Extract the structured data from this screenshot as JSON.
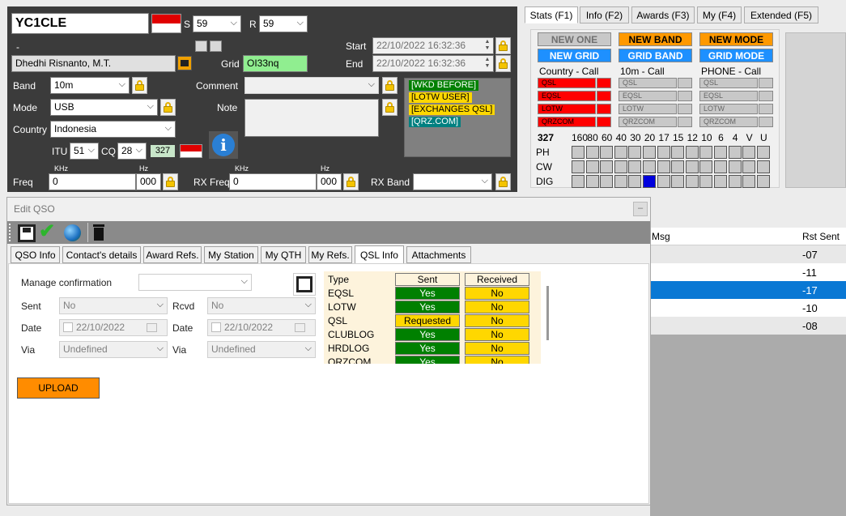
{
  "callsign": "YC1CLE",
  "rst": {
    "s_label": "S",
    "s_value": "59",
    "r_label": "R",
    "r_value": "59"
  },
  "operator_name": "Dhedhi Risnanto, M.T.",
  "dash": "-",
  "start": {
    "label": "Start",
    "value": "22/10/2022 16:32:36"
  },
  "end": {
    "label": "End",
    "value": "22/10/2022 16:32:36"
  },
  "grid": {
    "label": "Grid",
    "value": "OI33nq"
  },
  "band": {
    "label": "Band",
    "value": "10m"
  },
  "mode": {
    "label": "Mode",
    "value": "USB"
  },
  "country": {
    "label": "Country",
    "value": "Indonesia"
  },
  "itu": {
    "label": "ITU",
    "value": "51"
  },
  "cq": {
    "label": "CQ",
    "value": "28"
  },
  "dxcc": "327",
  "comment": {
    "label": "Comment",
    "value": ""
  },
  "note": {
    "label": "Note",
    "value": ""
  },
  "tags": [
    {
      "text": "[WKD BEFORE]",
      "bg": "#008000",
      "fg": "#ffffff"
    },
    {
      "text": "[LOTW USER]",
      "bg": "#ffd700",
      "fg": "#000000"
    },
    {
      "text": "[EXCHANGES QSL]",
      "bg": "#ffd700",
      "fg": "#000000"
    },
    {
      "text": "[QRZ.COM]",
      "bg": "#008080",
      "fg": "#ffffff"
    }
  ],
  "freq": {
    "label": "Freq",
    "khz_label": "KHz",
    "hz_label": "Hz",
    "khz": "0",
    "hz": "000"
  },
  "rxfreq": {
    "label": "RX Freq",
    "khz_label": "KHz",
    "hz_label": "Hz",
    "khz": "0",
    "hz": "000"
  },
  "rxband": {
    "label": "RX Band",
    "value": ""
  },
  "tabs": [
    "Stats (F1)",
    "Info (F2)",
    "Awards (F3)",
    "My (F4)",
    "Extended (F5)"
  ],
  "stats": {
    "buttons": [
      {
        "label": "NEW ONE",
        "bg": "#c8c8c8",
        "fg": "#707070"
      },
      {
        "label": "NEW BAND",
        "bg": "#ff9900",
        "fg": "#000000"
      },
      {
        "label": "NEW MODE",
        "bg": "#ff9900",
        "fg": "#000000"
      },
      {
        "label": "NEW GRID",
        "bg": "#1e90ff",
        "fg": "#ffffff"
      },
      {
        "label": "GRID BAND",
        "bg": "#1e90ff",
        "fg": "#ffffff"
      },
      {
        "label": "GRID MODE",
        "bg": "#1e90ff",
        "fg": "#ffffff"
      }
    ],
    "columns": [
      "Country - Call",
      "10m - Call",
      "PHONE - Call"
    ],
    "qsl_rows": [
      "QSL",
      "EQSL",
      "LOTW",
      "QRZCOM"
    ],
    "count": "327",
    "bands": [
      "160",
      "80",
      "60",
      "40",
      "30",
      "20",
      "17",
      "15",
      "12",
      "10",
      "6",
      "4",
      "V",
      "U"
    ],
    "modes": [
      "PH",
      "CW",
      "DIG"
    ],
    "worked_color": "#0000dd",
    "missing_color": "#ff0000"
  },
  "log": {
    "headers": [
      "Msg",
      "Rst Sent"
    ],
    "rows": [
      "-07",
      "-11",
      "-17",
      "-10",
      "-08"
    ],
    "selected_index": 2
  },
  "dialog": {
    "title": "Edit QSO",
    "tabs": [
      "QSO Info",
      "Contact's details",
      "Award Refs.",
      "My Station",
      "My QTH",
      "My Refs.",
      "QSL Info",
      "Attachments"
    ],
    "active_tab": "QSL Info",
    "manage_label": "Manage confirmation",
    "manage_value": "",
    "sent_label": "Sent",
    "sent_value": "No",
    "rcvd_label": "Rcvd",
    "rcvd_value": "No",
    "date_label": "Date",
    "date_sent": "22/10/2022",
    "date_rcvd": "22/10/2022",
    "via_label": "Via",
    "via_sent": "Undefined",
    "via_rcvd": "Undefined",
    "upload_label": "UPLOAD",
    "qsl_table": {
      "headers": [
        "Type",
        "Sent",
        "Received"
      ],
      "rows": [
        {
          "type": "EQSL",
          "sent": "Yes",
          "received": "No"
        },
        {
          "type": "LOTW",
          "sent": "Yes",
          "received": "No"
        },
        {
          "type": "QSL",
          "sent": "Requested",
          "received": "No"
        },
        {
          "type": "CLUBLOG",
          "sent": "Yes",
          "received": "No"
        },
        {
          "type": "HRDLOG",
          "sent": "Yes",
          "received": "No"
        },
        {
          "type": "QRZCOM",
          "sent": "Yes",
          "received": "No"
        }
      ]
    }
  }
}
